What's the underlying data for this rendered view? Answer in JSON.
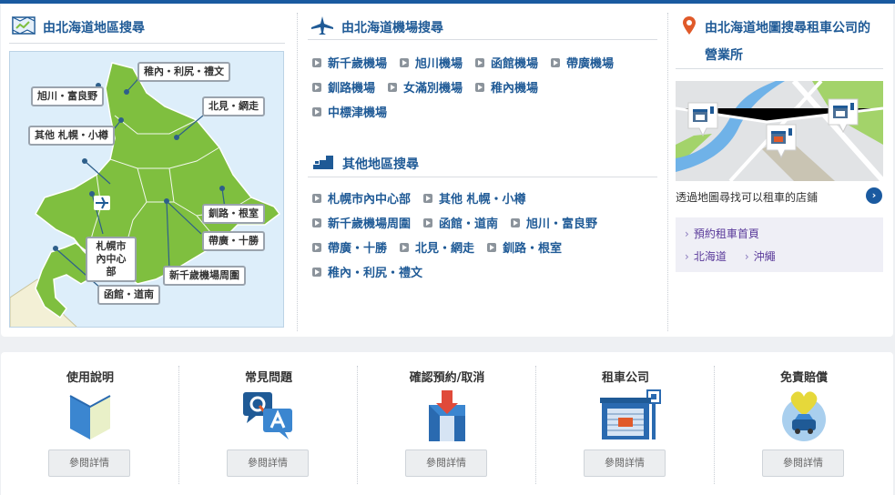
{
  "colors": {
    "brand_blue": "#1a5aa0",
    "link_blue": "#1f5a96",
    "map_green": "#7fbf3f",
    "map_sea": "#ddeefa"
  },
  "map_search": {
    "title": "由北海道地區搜尋",
    "icon": "map-icon",
    "regions": {
      "wakkanai": "稚內・利尻・禮文",
      "asahikawa": "旭川・富良野",
      "kitami": "北見・網走",
      "other": "其他 札幌・小樽",
      "kushiro": "釧路・根室",
      "obihiro": "帶廣・十勝",
      "sapporo": "札幌市內中心部",
      "chitose": "新千歲機場周圍",
      "hakodate": "函館・道南"
    }
  },
  "airport_search": {
    "title": "由北海道機場搜尋",
    "icon": "airplane-icon",
    "rows": [
      [
        "新千歲機場",
        "旭川機場",
        "函館機場",
        "帶廣機場"
      ],
      [
        "釧路機場",
        "女滿別機場",
        "稚內機場"
      ],
      [
        "中標津機場"
      ]
    ]
  },
  "other_search": {
    "title": "其他地區搜尋",
    "icon": "stairs-icon",
    "rows": [
      [
        "札幌市內中心部",
        "其他 札幌・小樽"
      ],
      [
        "新千歲機場周圍",
        "函館・道南",
        "旭川・富良野"
      ],
      [
        "帶廣・十勝",
        "北見・網走",
        "釧路・根室"
      ],
      [
        "稚內・利尻・禮文"
      ]
    ]
  },
  "office_search": {
    "title_line1": "由北海道地圖搜尋租車公司的",
    "title_line2": "營業所",
    "icon": "location-pin-icon",
    "caption": "透過地圖尋找可以租車的店鋪",
    "caption_btn": "›",
    "links": [
      "預約租車首頁",
      "北海道",
      "沖繩"
    ]
  },
  "bottom_cards": [
    {
      "title": "使用說明",
      "icon": "beginner-mark-icon",
      "button": "參閱詳情"
    },
    {
      "title": "常見問題",
      "icon": "qa-bubbles-icon",
      "button": "參閱詳情"
    },
    {
      "title": "確認預約/取消",
      "icon": "reservation-box-icon",
      "button": "參閱詳情"
    },
    {
      "title": "租車公司",
      "icon": "car-rental-shop-icon",
      "button": "參閱詳情"
    },
    {
      "title": "免責賠償",
      "icon": "car-protection-heart-icon",
      "button": "參閱詳情"
    }
  ]
}
